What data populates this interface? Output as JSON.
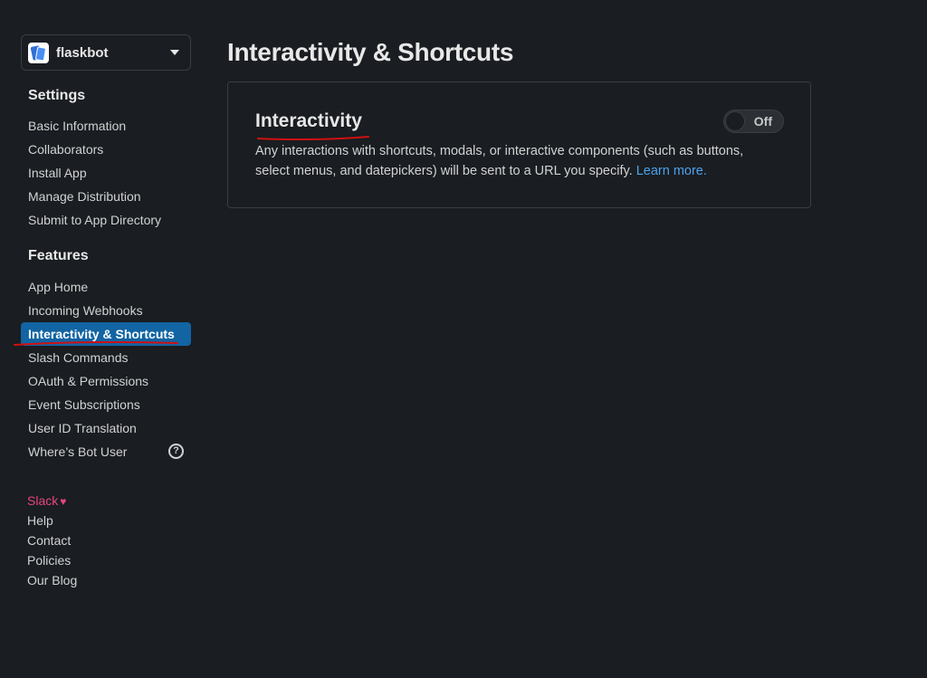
{
  "app": {
    "name": "flaskbot"
  },
  "sidebar": {
    "settings_title": "Settings",
    "settings_items": [
      {
        "label": "Basic Information"
      },
      {
        "label": "Collaborators"
      },
      {
        "label": "Install App"
      },
      {
        "label": "Manage Distribution"
      },
      {
        "label": "Submit to App Directory"
      }
    ],
    "features_title": "Features",
    "features_items": [
      {
        "label": "App Home"
      },
      {
        "label": "Incoming Webhooks"
      },
      {
        "label": "Interactivity & Shortcuts",
        "active": true
      },
      {
        "label": "Slash Commands"
      },
      {
        "label": "OAuth & Permissions"
      },
      {
        "label": "Event Subscriptions"
      },
      {
        "label": "User ID Translation"
      },
      {
        "label": "Where’s Bot User"
      }
    ],
    "help_icon_symbol": "?"
  },
  "footer": {
    "brand_label": "Slack",
    "heart_symbol": "♥",
    "links": [
      {
        "label": "Help"
      },
      {
        "label": "Contact"
      },
      {
        "label": "Policies"
      },
      {
        "label": "Our Blog"
      }
    ]
  },
  "main": {
    "page_title": "Interactivity & Shortcuts",
    "card": {
      "title": "Interactivity",
      "description": "Any interactions with shortcuts, modals, or interactive components (such as buttons, select menus, and datepickers) will be sent to a URL you specify. ",
      "learn_more": "Learn more.",
      "toggle_label": "Off",
      "toggle_on": false
    }
  },
  "colors": {
    "background": "#1a1d21",
    "active_nav": "#1264a3",
    "link": "#4aa3f0",
    "slack_brand": "#e8467c",
    "annotation_underline": "#d01010"
  }
}
